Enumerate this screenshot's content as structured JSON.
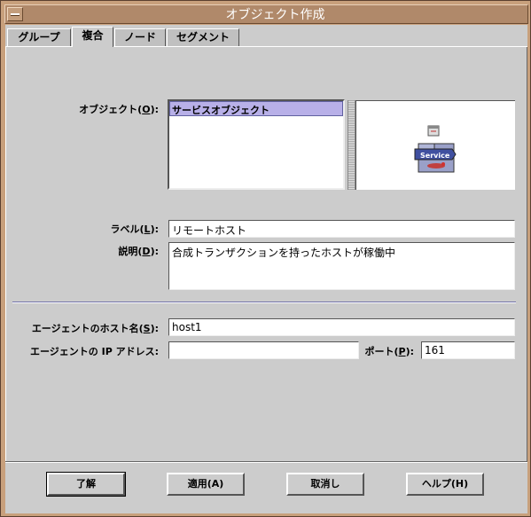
{
  "window": {
    "title": "オブジェクト作成"
  },
  "tabs": [
    {
      "label": "グループ",
      "active": false
    },
    {
      "label": "複合",
      "active": true
    },
    {
      "label": "ノード",
      "active": false
    },
    {
      "label": "セグメント",
      "active": false
    }
  ],
  "object_section": {
    "label_prefix": "オブジェクト(",
    "label_mnemonic": "O",
    "label_suffix": "):",
    "list_items": [
      "サービスオブジェクト"
    ],
    "preview_icon": "service-object-icon",
    "preview_caption": "Service"
  },
  "label_field": {
    "label_prefix": "ラベル(",
    "label_mnemonic": "L",
    "label_suffix": "):",
    "value": "リモートホスト"
  },
  "description_field": {
    "label_prefix": "説明(",
    "label_mnemonic": "D",
    "label_suffix": "):",
    "value": "合成トランザクションを持ったホストが稼働中"
  },
  "agent_host_field": {
    "label_prefix": "エージェントのホスト名(",
    "label_mnemonic": "S",
    "label_suffix": "):",
    "value": "host1"
  },
  "agent_ip_field": {
    "label": "エージェントの IP アドレス:",
    "value": ""
  },
  "port_field": {
    "label_prefix": "ポート(",
    "label_mnemonic": "P",
    "label_suffix": "):",
    "value": "161"
  },
  "buttons": {
    "ok": "了解",
    "apply": "適用(A)",
    "cancel": "取消し",
    "help": "ヘルプ(H)"
  },
  "colors": {
    "window_frame": "#c8a07c",
    "title_bar": "#b0896a",
    "panel_bg": "#cccccc",
    "list_selection": "#b8b0e8"
  }
}
